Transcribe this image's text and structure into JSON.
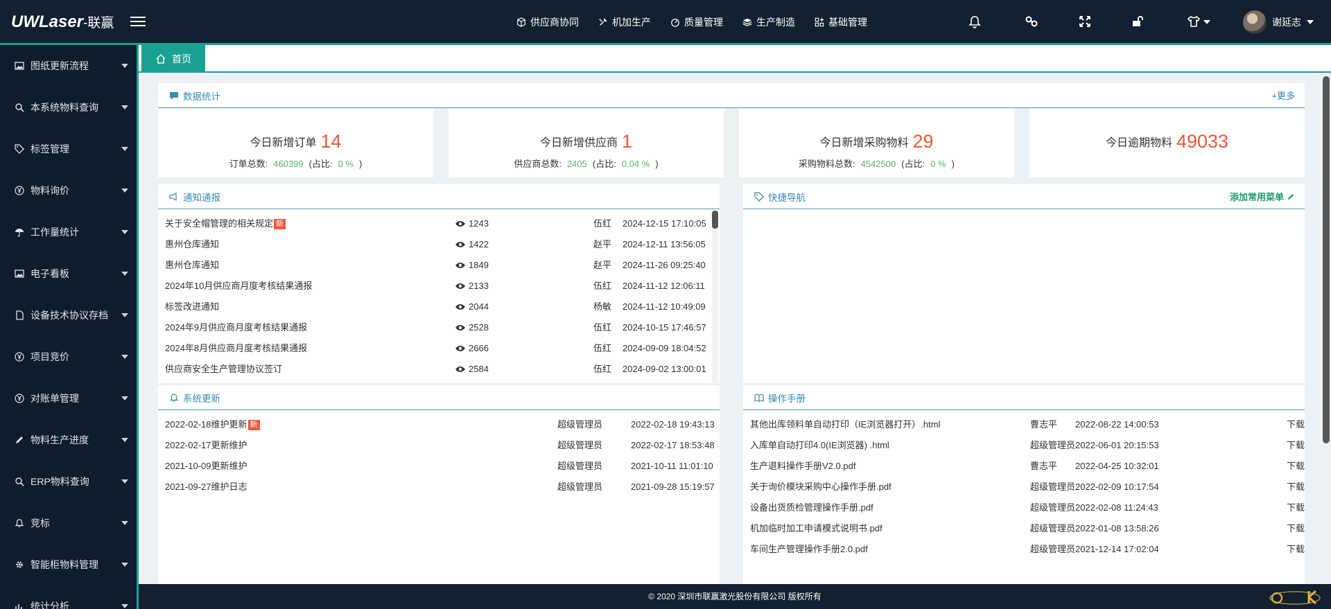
{
  "header": {
    "logo_main": "UWLaser",
    "logo_cn": "-联赢",
    "nav": [
      {
        "label": "供应商协同",
        "icon": "cube-icon"
      },
      {
        "label": "机加生产",
        "icon": "wrench-icon"
      },
      {
        "label": "质量管理",
        "icon": "gauge-icon"
      },
      {
        "label": "生产制造",
        "icon": "layers-icon"
      },
      {
        "label": "基础管理",
        "icon": "grid-plus-icon"
      }
    ],
    "user_name": "谢延志"
  },
  "sidebar": {
    "items": [
      {
        "label": "图纸更新流程",
        "icon": "image-icon"
      },
      {
        "label": "本系统物料查询",
        "icon": "search-icon"
      },
      {
        "label": "标签管理",
        "icon": "tag-icon"
      },
      {
        "label": "物料询价",
        "icon": "yen-icon"
      },
      {
        "label": "工作量统计",
        "icon": "umbrella-icon"
      },
      {
        "label": "电子看板",
        "icon": "image-icon"
      },
      {
        "label": "设备技术协议存档",
        "icon": "file-icon"
      },
      {
        "label": "项目竞价",
        "icon": "yen-icon"
      },
      {
        "label": "对账单管理",
        "icon": "yen-icon"
      },
      {
        "label": "物料生产进度",
        "icon": "pencil-icon"
      },
      {
        "label": "ERP物料查询",
        "icon": "search-icon"
      },
      {
        "label": "竞标",
        "icon": "bell-icon"
      },
      {
        "label": "智能柜物料管理",
        "icon": "gear-icon"
      },
      {
        "label": "统计分析",
        "icon": "bar-chart-icon"
      }
    ]
  },
  "tabs": {
    "home": "首页"
  },
  "stats_panel": {
    "title": "数据统计",
    "more": "+更多"
  },
  "stats": [
    {
      "label": "今日新增订单",
      "value": "14",
      "sub_label": "订单总数:",
      "sub_total": "460399",
      "ratio_prefix": "(占比:",
      "ratio": "0 %",
      "ratio_suffix": ")"
    },
    {
      "label": "今日新增供应商",
      "value": "1",
      "sub_label": "供应商总数:",
      "sub_total": "2405",
      "ratio_prefix": "(占比:",
      "ratio": "0.04 %",
      "ratio_suffix": ")"
    },
    {
      "label": "今日新增采购物料",
      "value": "29",
      "sub_label": "采购物料总数:",
      "sub_total": "4542500",
      "ratio_prefix": "(占比:",
      "ratio": "0 %",
      "ratio_suffix": ")"
    },
    {
      "label": "今日逾期物料",
      "value": "49033"
    }
  ],
  "notices": {
    "title": "通知通报",
    "new_badge": "新",
    "rows": [
      {
        "title": "关于安全帽管理的相关规定",
        "views": "1243",
        "author": "伍红",
        "time": "2024-12-15 17:10:05",
        "is_new": true
      },
      {
        "title": "惠州仓库通知",
        "views": "1422",
        "author": "赵平",
        "time": "2024-12-11 13:56:05"
      },
      {
        "title": "惠州仓库通知",
        "views": "1849",
        "author": "赵平",
        "time": "2024-11-26 09:25:40"
      },
      {
        "title": "2024年10月供应商月度考核结果通报",
        "views": "2133",
        "author": "伍红",
        "time": "2024-11-12 12:06:11"
      },
      {
        "title": "标签改进通知",
        "views": "2044",
        "author": "杨敏",
        "time": "2024-11-12 10:49:09"
      },
      {
        "title": "2024年9月供应商月度考核结果通报",
        "views": "2528",
        "author": "伍红",
        "time": "2024-10-15 17:46:57"
      },
      {
        "title": "2024年8月供应商月度考核结果通报",
        "views": "2666",
        "author": "伍红",
        "time": "2024-09-09 18:04:52"
      },
      {
        "title": "供应商安全生产管理协议签订",
        "views": "2584",
        "author": "伍红",
        "time": "2024-09-02 13:00:01"
      }
    ]
  },
  "quick_nav": {
    "title": "快捷导航",
    "add_label": "添加常用菜单"
  },
  "system_updates": {
    "title": "系统更新",
    "new_badge": "新",
    "rows": [
      {
        "title": "2022-02-18维护更新",
        "author": "超级管理员",
        "time": "2022-02-18 19:43:13",
        "is_new": true
      },
      {
        "title": "2022-02-17更新维护",
        "author": "超级管理员",
        "time": "2022-02-17 18:53:48"
      },
      {
        "title": "2021-10-09更新维护",
        "author": "超级管理员",
        "time": "2021-10-11 11:01:10"
      },
      {
        "title": "2021-09-27维护日志",
        "author": "超级管理员",
        "time": "2021-09-28 15:19:57"
      }
    ]
  },
  "manuals": {
    "title": "操作手册",
    "download_label": "下载",
    "rows": [
      {
        "title": "其他出库领料单自动打印（IE浏览器打开）.html",
        "author": "曹志平",
        "time": "2022-08-22 14:00:53"
      },
      {
        "title": "入库单自动打印4.0(IE浏览器) .html",
        "author": "超级管理员",
        "time": "2022-06-01 20:15:53"
      },
      {
        "title": "生产退料操作手册V2.0.pdf",
        "author": "曹志平",
        "time": "2022-04-25 10:32:01"
      },
      {
        "title": "关于询价模块采购中心操作手册.pdf",
        "author": "超级管理员",
        "time": "2022-02-09 10:17:54"
      },
      {
        "title": "设备出货质检管理操作手册.pdf",
        "author": "超级管理员",
        "time": "2022-02-08 11:24:43"
      },
      {
        "title": "机加临时加工申请模式说明书.pdf",
        "author": "超级管理员",
        "time": "2022-01-08 13:58:26"
      },
      {
        "title": "车间生产管理操作手册2.0.pdf",
        "author": "超级管理员",
        "time": "2021-12-14 17:02:04"
      }
    ]
  },
  "footer": {
    "text": "© 2020  深圳市联赢激光股份有限公司  版权所有"
  },
  "colors": {
    "topbar": "#12202f",
    "accent": "#1aa194",
    "highlight": "#f0573a",
    "green": "#58b368",
    "link": "#3b8db1"
  }
}
